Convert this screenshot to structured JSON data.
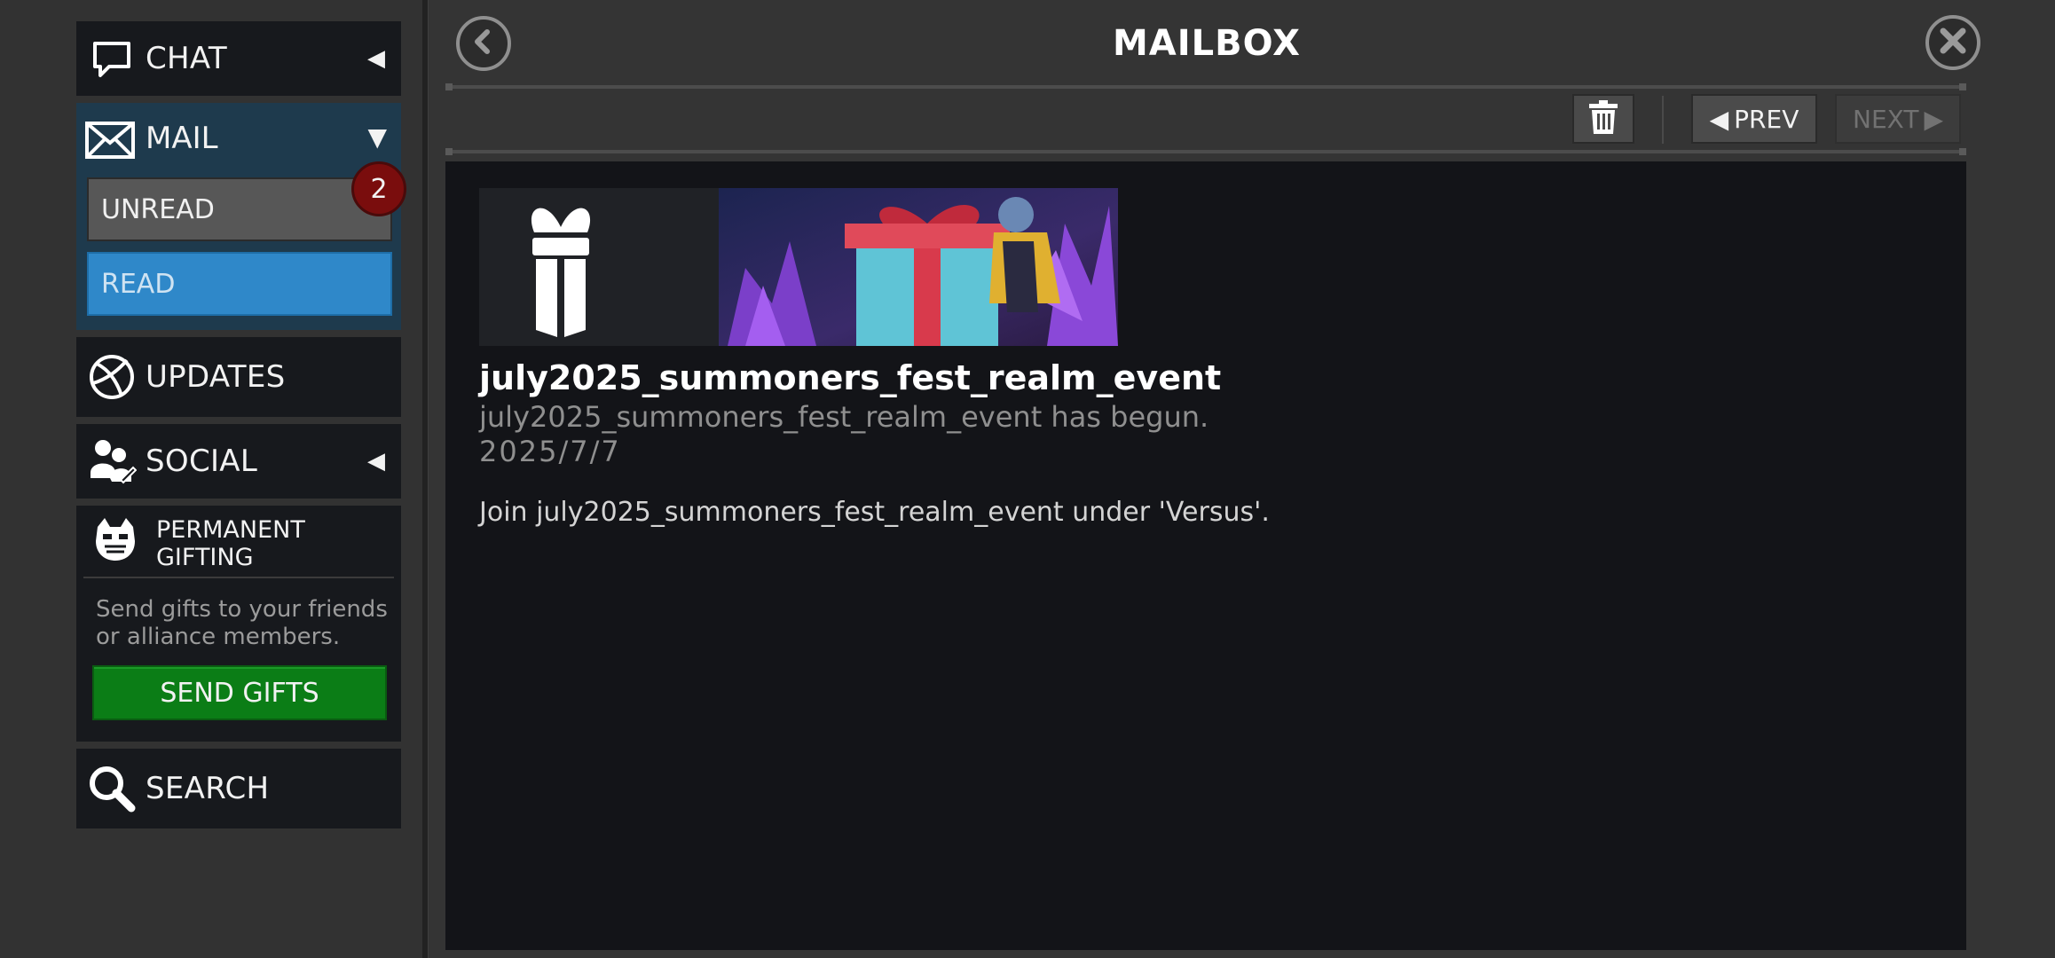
{
  "header": {
    "title": "MAILBOX",
    "back_icon": "back-arrow-icon",
    "close_icon": "close-x-icon"
  },
  "toolbar": {
    "delete_icon": "trash-icon",
    "prev_label": "PREV",
    "next_label": "NEXT"
  },
  "sidebar": {
    "chat": {
      "label": "CHAT",
      "icon": "chat-bubble-icon"
    },
    "mail": {
      "label": "MAIL",
      "icon": "envelope-icon",
      "unread_label": "UNREAD",
      "read_label": "READ",
      "unread_count": "2"
    },
    "updates": {
      "label": "UPDATES",
      "icon": "globe-icon"
    },
    "social": {
      "label": "SOCIAL",
      "icon": "people-icon"
    },
    "gifting": {
      "title": "PERMANENT GIFTING",
      "icon": "gifting-character-icon",
      "description": "Send gifts to your friends or alliance members.",
      "button_label": "SEND GIFTS"
    },
    "search": {
      "label": "SEARCH",
      "icon": "magnifier-icon"
    }
  },
  "message": {
    "title": "july2025_summoners_fest_realm_event",
    "subtitle": "july2025_summoners_fest_realm_event has begun.",
    "date": "2025/7/7",
    "body": "Join july2025_summoners_fest_realm_event under 'Versus'.",
    "banner_icon": "gift-box-icon"
  },
  "colors": {
    "read_active": "#2f88c9",
    "send_gifts": "#0b7d16",
    "badge": "#7a0d0d"
  }
}
